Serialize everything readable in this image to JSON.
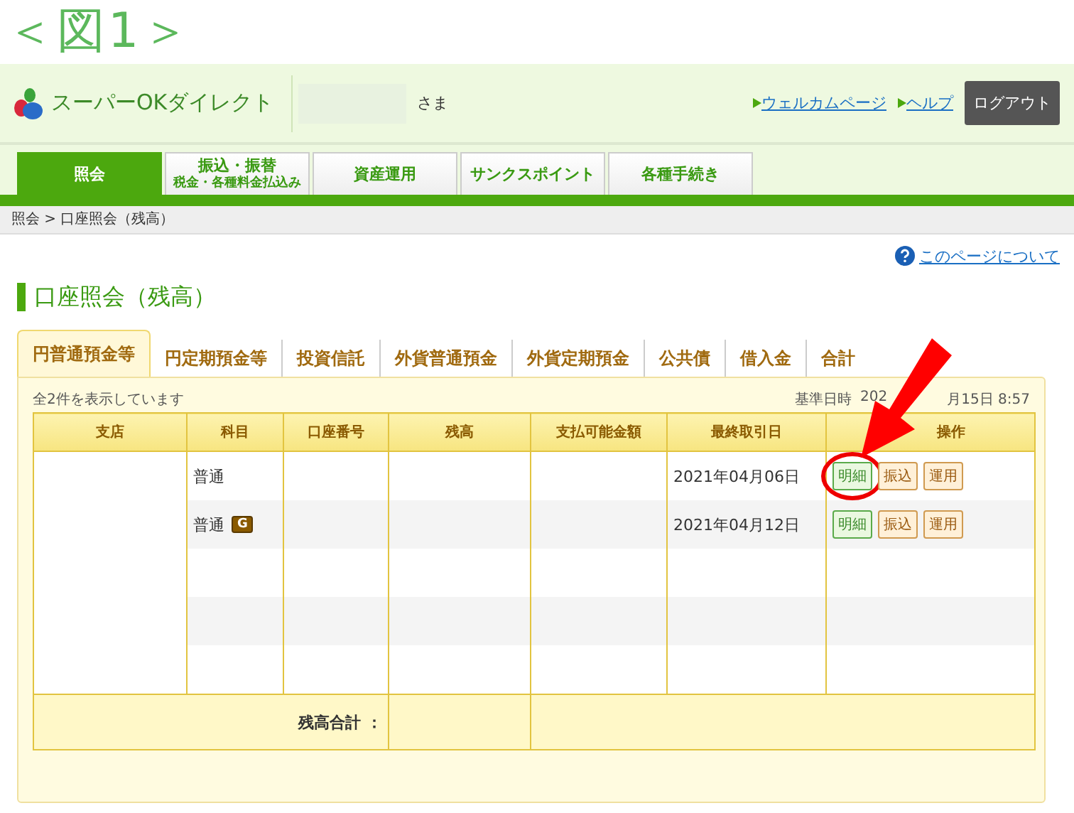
{
  "figure_label": "＜図1＞",
  "header": {
    "brand": "スーパーOKダイレクト",
    "user_suffix": "さま",
    "links": [
      "ウェルカムページ",
      "ヘルプ"
    ],
    "logout": "ログアウト"
  },
  "nav_tabs": [
    {
      "lines": [
        "照会"
      ],
      "selected": true
    },
    {
      "lines": [
        "振込・振替",
        "税金・各種料金払込み"
      ],
      "selected": false
    },
    {
      "lines": [
        "資産運用"
      ],
      "selected": false
    },
    {
      "lines": [
        "サンクスポイント"
      ],
      "selected": false
    },
    {
      "lines": [
        "各種手続き"
      ],
      "selected": false
    }
  ],
  "breadcrumb": "照会 > 口座照会（残高）",
  "help_link": "このページについて",
  "page_title": "口座照会（残高）",
  "account_tabs": [
    {
      "label": "円普通預金等",
      "selected": true
    },
    {
      "label": "円定期預金等",
      "selected": false
    },
    {
      "label": "投資信託",
      "selected": false
    },
    {
      "label": "外貨普通預金",
      "selected": false
    },
    {
      "label": "外貨定期預金",
      "selected": false
    },
    {
      "label": "公共債",
      "selected": false
    },
    {
      "label": "借入金",
      "selected": false
    },
    {
      "label": "合計",
      "selected": false
    }
  ],
  "summary": {
    "count_text": "全2件を表示しています",
    "as_of_label": "基準日時",
    "as_of_start": "202",
    "as_of_end": "月15日 8:57"
  },
  "table": {
    "columns": [
      "支店",
      "科目",
      "口座番号",
      "残高",
      "支払可能金額",
      "最終取引日",
      "操作"
    ],
    "rows": [
      {
        "kind": "account",
        "subject": "普通",
        "last_date": "2021年04月06日",
        "actions": [
          {
            "label": "明細",
            "kind": "detail",
            "highlighted": true
          },
          {
            "label": "振込",
            "kind": "other",
            "highlighted": false
          },
          {
            "label": "運用",
            "kind": "other",
            "highlighted": false
          }
        ]
      },
      {
        "kind": "account",
        "subject": "普通",
        "badge": "G",
        "last_date": "2021年04月12日",
        "actions": [
          {
            "label": "明細",
            "kind": "detail",
            "highlighted": false
          },
          {
            "label": "振込",
            "kind": "other",
            "highlighted": false
          },
          {
            "label": "運用",
            "kind": "other",
            "highlighted": false
          }
        ]
      },
      {
        "kind": "empty"
      },
      {
        "kind": "empty"
      },
      {
        "kind": "empty"
      }
    ],
    "total_label": "残高合計 ："
  }
}
